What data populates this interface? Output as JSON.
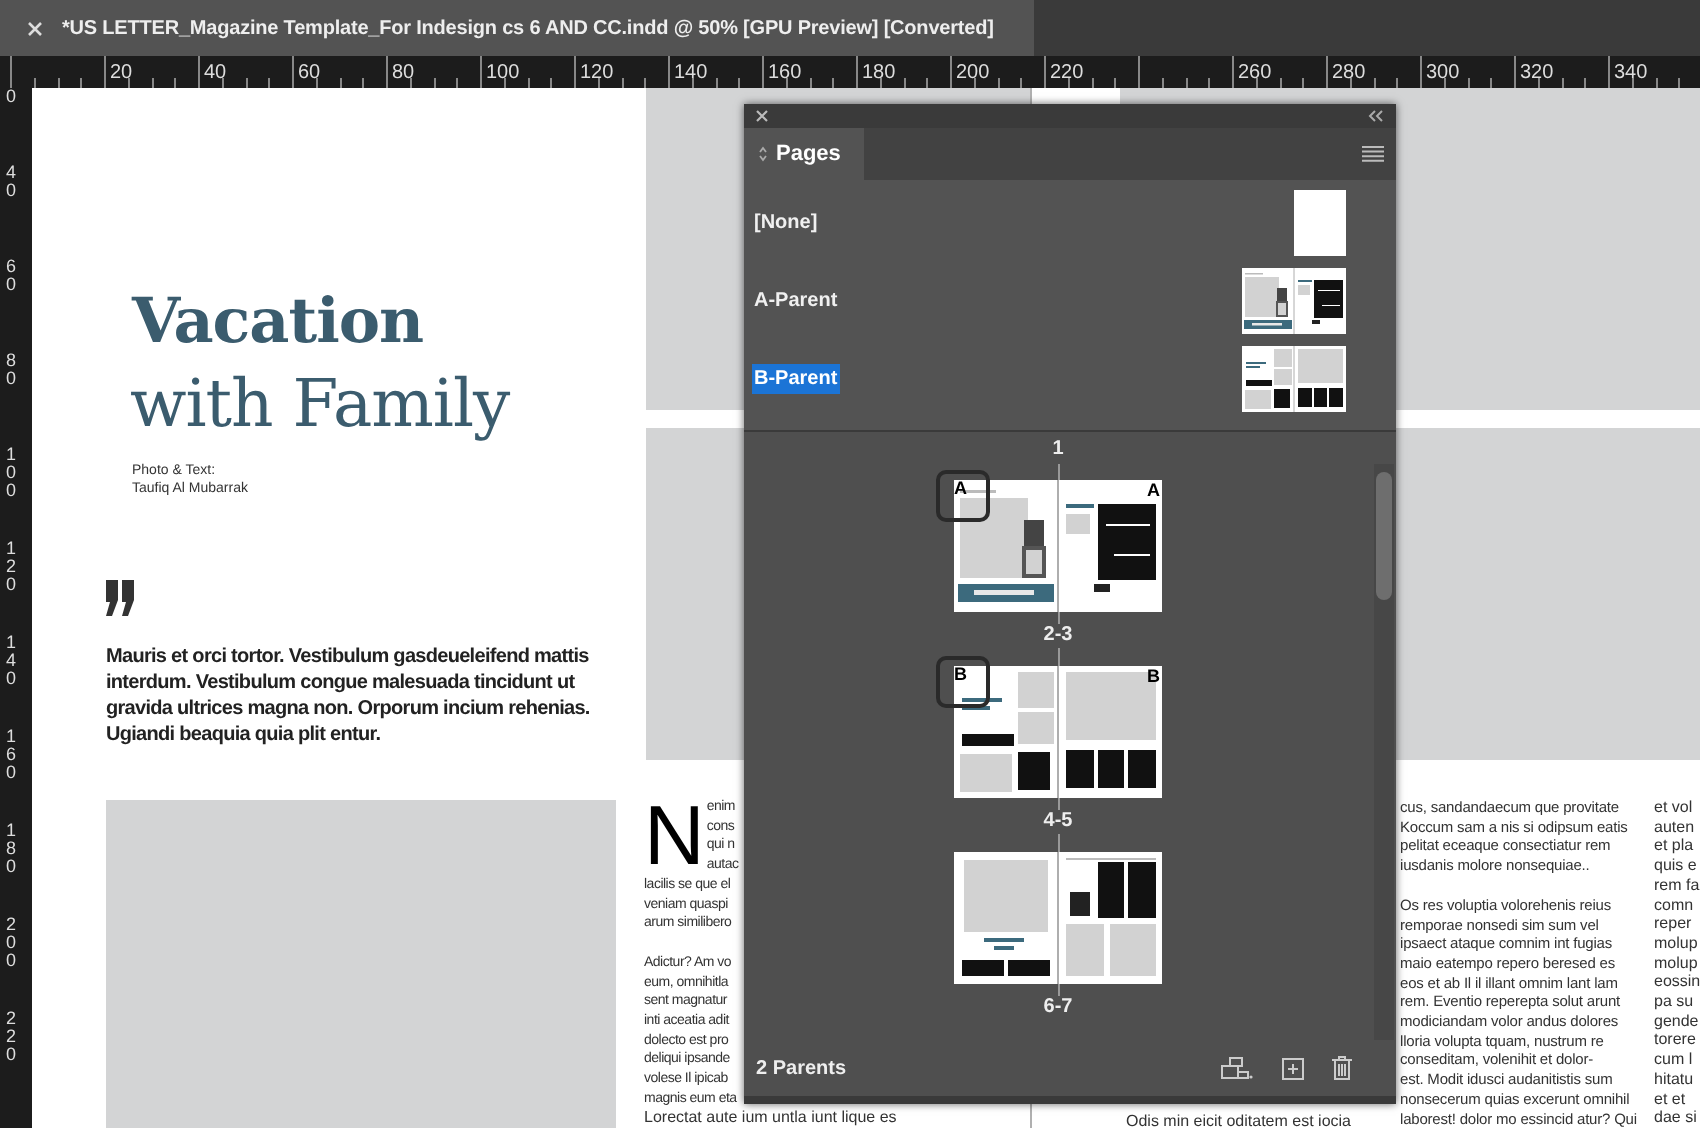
{
  "document_tab": {
    "title": "*US LETTER_Magazine Template_For Indesign cs 6 AND CC.indd @ 50% [GPU Preview] [Converted]"
  },
  "horizontal_ruler": {
    "left_labels": [
      "20",
      "40",
      "60",
      "80",
      "100",
      "120",
      "140",
      "160",
      "180",
      "200",
      "220"
    ],
    "right_labels": [
      "260",
      "280",
      "300",
      "320",
      "340"
    ]
  },
  "vertical_ruler": {
    "top_fragment": "0",
    "labels": [
      "40",
      "60",
      "80",
      "100",
      "120",
      "140",
      "160",
      "180",
      "200",
      "220"
    ]
  },
  "left_page": {
    "title_bold": "Vacation",
    "title_light": "with Family",
    "credit_lines": [
      "Photo & Text:",
      "Taufiq Al Mubarrak"
    ],
    "pull_quote": "Mauris et orci tortor. Vestibulum gasdeueleifend mattis interdum. Vestibulum congue malesuada tincidunt ut gravida ultrices magna non. Orporum incium rehenias. Ugiandi beaquia quia plit entur."
  },
  "middle_column": {
    "drop_cap": {
      "letter": "N",
      "lines": [
        "enim",
        "cons",
        "qui n",
        "autac"
      ]
    },
    "paragraphs": [
      {
        "lines": [
          "lacilis se que el",
          "veniam quaspi",
          "arum similibero"
        ]
      },
      {
        "lines": [
          "Adictur? Am vo",
          "eum, omnihitla",
          "sent magnatur",
          "inti aceatia adit",
          "dolecto est pro",
          "deliqui ipsande",
          "volese Il ipicab",
          "magnis eum eta"
        ]
      }
    ],
    "bottom_line": "Lorectat aute ium untla iunt lique es"
  },
  "right_page_fragment": {
    "bottom_line": "Odis min eicit oditatem est iocia"
  },
  "right_column": {
    "paragraphs": [
      {
        "lines": [
          "cus, sandandaecum que provitate",
          "Koccum sam a nis si odipsum eatis",
          "pelitat eceaque consectiatur rem",
          "iusdanis molore nonsequiae.."
        ]
      },
      {
        "lines": [
          "Os res voluptia volorehenis reius",
          "remporae nonsedi sim sum vel",
          "ipsaect ataque comnim int fugias",
          "maio eatempo repero beresed es",
          "eos et ab Il il illant omnim lant lam",
          "rem. Eventio reperepta solut arunt",
          "modiciandam volor andus dolores",
          "lloria volupta tquam, nustrum re",
          "conseditam, volenihit et dolor-",
          "est. Modit idusci audanitistis sum",
          "nonsecerum quias excerunt omnihil",
          "laborest! dolor mo essincid atur? Qui"
        ]
      }
    ]
  },
  "edge_column": {
    "lines": [
      "et vol",
      "auten",
      "et pla",
      "quis e",
      "rem fa",
      "comn",
      "reper",
      "molup",
      "molup",
      "eossin",
      "pa su",
      "gende",
      "torere",
      "cum l",
      "hitatu",
      "et et",
      "dae si"
    ]
  },
  "pages_panel": {
    "tab": {
      "label": "Pages",
      "selected": true
    },
    "parents": [
      {
        "label": "[None]",
        "kind": "blank",
        "selected": false
      },
      {
        "label": "A-Parent",
        "kind": "a",
        "selected": false
      },
      {
        "label": "B-Parent",
        "kind": "b",
        "selected": true
      }
    ],
    "partial_spread_label": "1",
    "spreads": [
      {
        "label": "2-3",
        "kind": "a",
        "parent_letters": [
          "A",
          "A"
        ]
      },
      {
        "label": "4-5",
        "kind": "b",
        "parent_letters": [
          "B",
          "B"
        ]
      },
      {
        "label": "6-7",
        "kind": "c"
      }
    ],
    "footer": {
      "count": "2 Parents"
    }
  }
}
